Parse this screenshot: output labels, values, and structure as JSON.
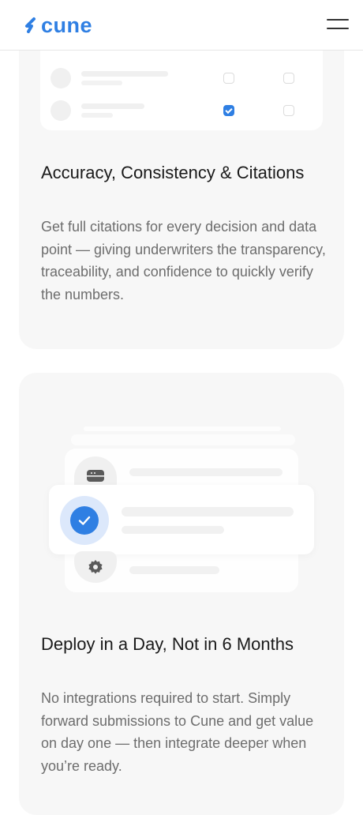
{
  "header": {
    "logo_text": "cune",
    "logo_icon": "bolt-icon",
    "menu_icon": "hamburger-menu-icon",
    "brand_color": "#2f7fe3"
  },
  "cards": [
    {
      "illustration": "checklist-table",
      "checkbox_rows": [
        {
          "col1": "checked",
          "col2": "checked"
        },
        {
          "col1": "unchecked",
          "col2": "unchecked"
        },
        {
          "col1": "checked",
          "col2": "unchecked"
        }
      ],
      "title": "Accuracy, Consistency & Citations",
      "body": "Get full citations for every decision and data point — giving underwriters the transparency, traceability, and confidence to quickly verify the numbers."
    },
    {
      "illustration": "deploy-stack",
      "icons": [
        "server-icon",
        "checkmark-icon",
        "gear-icon"
      ],
      "title": "Deploy in a Day, Not in 6 Months",
      "body": "No integrations required to start. Simply forward submissions to Cune and get value on day one — then integrate deeper when you’re ready."
    }
  ]
}
